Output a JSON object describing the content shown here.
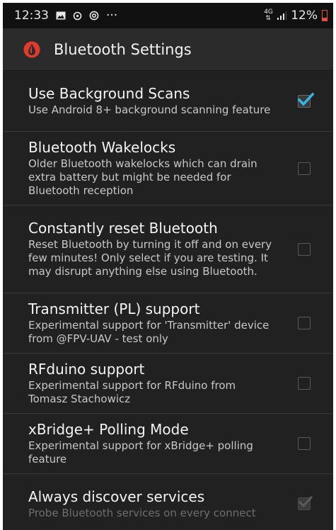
{
  "status_bar": {
    "time": "12:33",
    "notification_icons": [
      "image-icon",
      "data-saver-icon",
      "at-sign-icon",
      "more-dots-icon"
    ],
    "ellipsis": "···",
    "network_type_top": "4G",
    "network_type_bottom": "⇅",
    "battery_percent": "12%",
    "battery_color": "#e84b3c"
  },
  "app_bar": {
    "icon": "xdrip-drop-icon",
    "title": "Bluetooth Settings",
    "accent_color": "#e23b2e"
  },
  "preferences": [
    {
      "title": "Use Background Scans",
      "summary": "Use Android 8+ background scanning feature",
      "checked": true,
      "enabled": true
    },
    {
      "title": "Bluetooth Wakelocks",
      "summary": "Older Bluetooth wakelocks which can drain extra battery but might be needed for Bluetooth reception",
      "checked": false,
      "enabled": true
    },
    {
      "title": "Constantly reset Bluetooth",
      "summary": "Reset Bluetooth by turning it off and on every few minutes! Only select if you are testing. It may disrupt anything else using Bluetooth.",
      "checked": false,
      "enabled": true
    },
    {
      "title": "Transmitter (PL) support",
      "summary": "Experimental support for 'Transmitter' device from @FPV-UAV - test only",
      "checked": false,
      "enabled": true
    },
    {
      "title": "RFduino support",
      "summary": "Experimental support for RFduino from Tomasz Stachowicz",
      "checked": false,
      "enabled": true
    },
    {
      "title": "xBridge+ Polling Mode",
      "summary": "Experimental support for xBridge+ polling feature",
      "checked": false,
      "enabled": true
    },
    {
      "title": "Always discover services",
      "summary": "Probe Bluetooth services on every connect",
      "checked": true,
      "enabled": false
    }
  ],
  "colors": {
    "check_accent": "#33b5e5",
    "background": "#212121"
  }
}
